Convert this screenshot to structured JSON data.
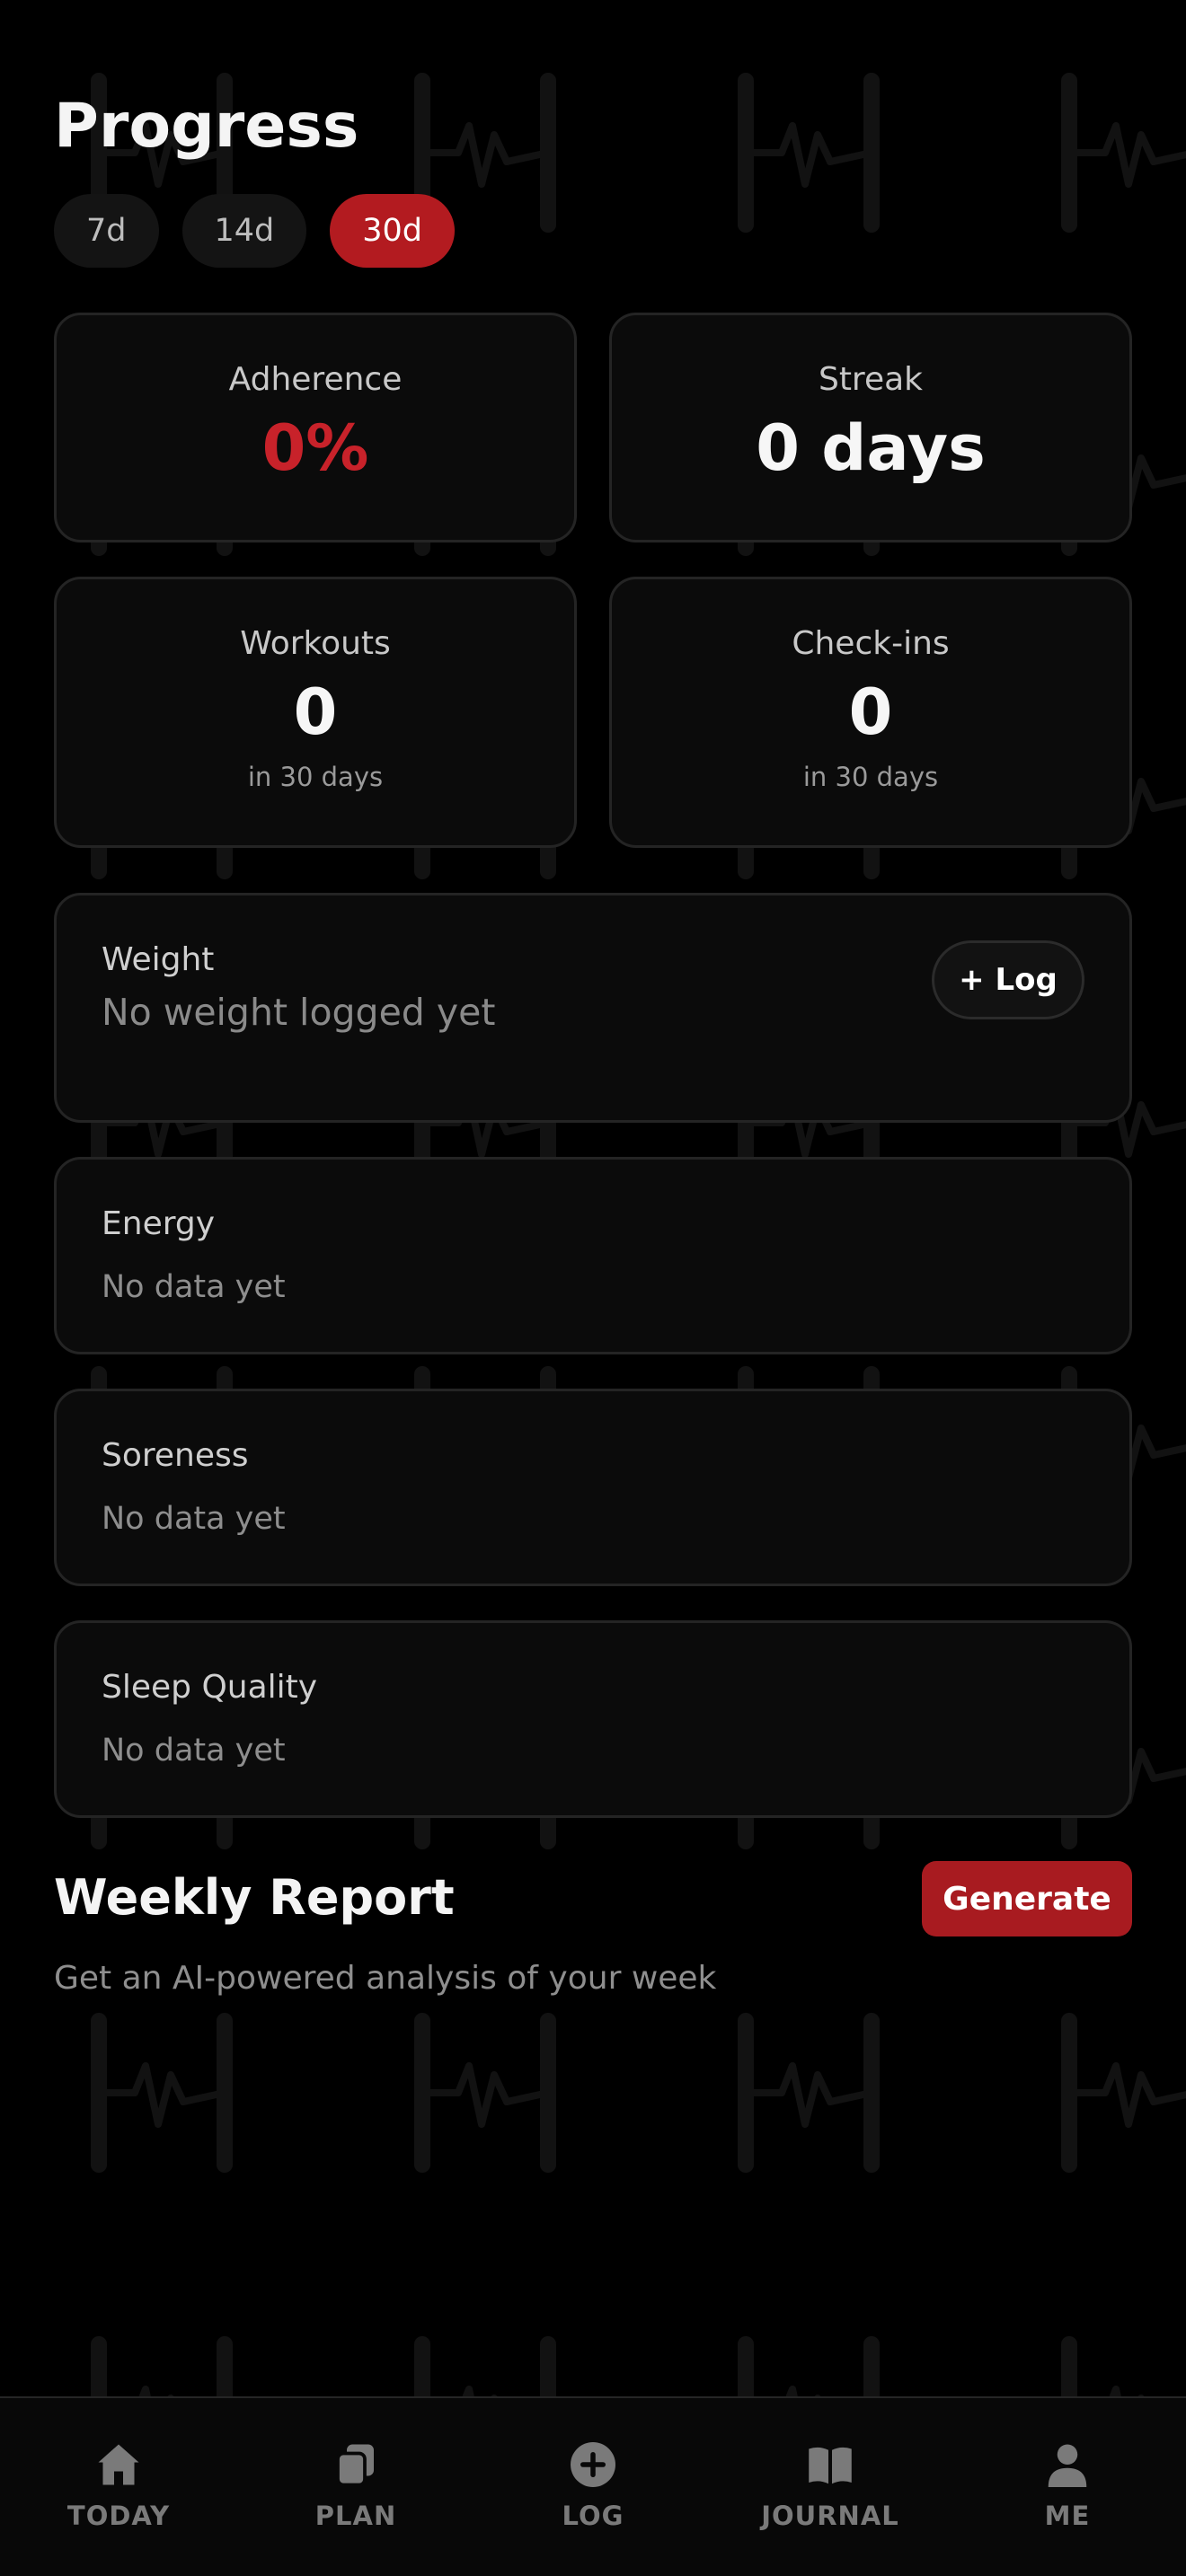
{
  "header": {
    "title": "Progress"
  },
  "ranges": {
    "items": [
      "7d",
      "14d",
      "30d"
    ],
    "selected": "30d"
  },
  "stats": {
    "adherence": {
      "label": "Adherence",
      "value": "0%"
    },
    "streak": {
      "label": "Streak",
      "value": "0 days"
    },
    "workouts": {
      "label": "Workouts",
      "value": "0",
      "sub": "in 30 days"
    },
    "checkins": {
      "label": "Check-ins",
      "value": "0",
      "sub": "in 30 days"
    }
  },
  "weight": {
    "label": "Weight",
    "empty": "No weight logged yet",
    "log_label": "+ Log"
  },
  "energy": {
    "label": "Energy",
    "empty": "No data yet"
  },
  "soreness": {
    "label": "Soreness",
    "empty": "No data yet"
  },
  "sleep": {
    "label": "Sleep Quality",
    "empty": "No data yet"
  },
  "report": {
    "title": "Weekly Report",
    "subtitle": "Get an AI-powered analysis of your week",
    "generate_label": "Generate"
  },
  "tabbar": {
    "items": [
      {
        "label": "TODAY",
        "icon": "home-icon"
      },
      {
        "label": "PLAN",
        "icon": "cards-icon"
      },
      {
        "label": "LOG",
        "icon": "add-circle-icon"
      },
      {
        "label": "JOURNAL",
        "icon": "book-icon"
      },
      {
        "label": "ME",
        "icon": "person-icon"
      }
    ]
  },
  "colors": {
    "background": "#000000",
    "accent": "#b31b20",
    "card": "#0b0b0b",
    "card_border": "#242424",
    "muted_text": "#8e8e8e"
  }
}
